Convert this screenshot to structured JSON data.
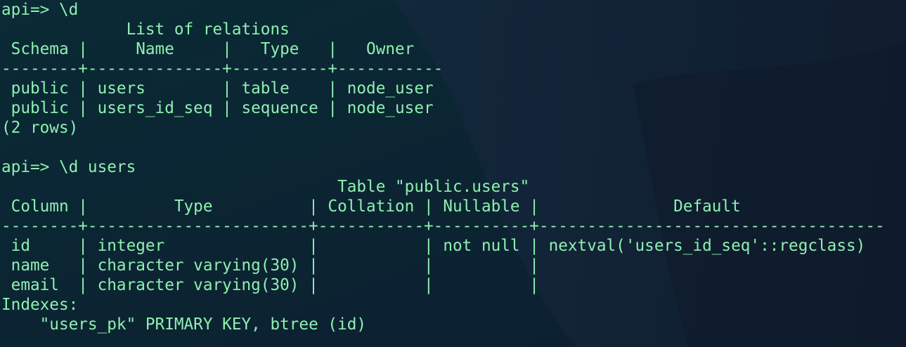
{
  "terminal": {
    "lines": [
      "api=> \\d",
      "             List of relations",
      " Schema |     Name     |   Type   |   Owner",
      "--------+--------------+----------+-----------",
      " public | users        | table    | node_user",
      " public | users_id_seq | sequence | node_user",
      "(2 rows)",
      "",
      "api=> \\d users",
      "                                   Table \"public.users\"",
      " Column |         Type          | Collation | Nullable |              Default",
      "--------+-----------------------+-----------+----------+------------------------------------",
      " id     | integer               |           | not null | nextval('users_id_seq'::regclass)",
      " name   | character varying(30) |           |          |",
      " email  | character varying(30) |           |          |",
      "Indexes:",
      "    \"users_pk\" PRIMARY KEY, btree (id)"
    ]
  },
  "colors": {
    "background": "#0c2233",
    "text": "#8ef0b0"
  }
}
